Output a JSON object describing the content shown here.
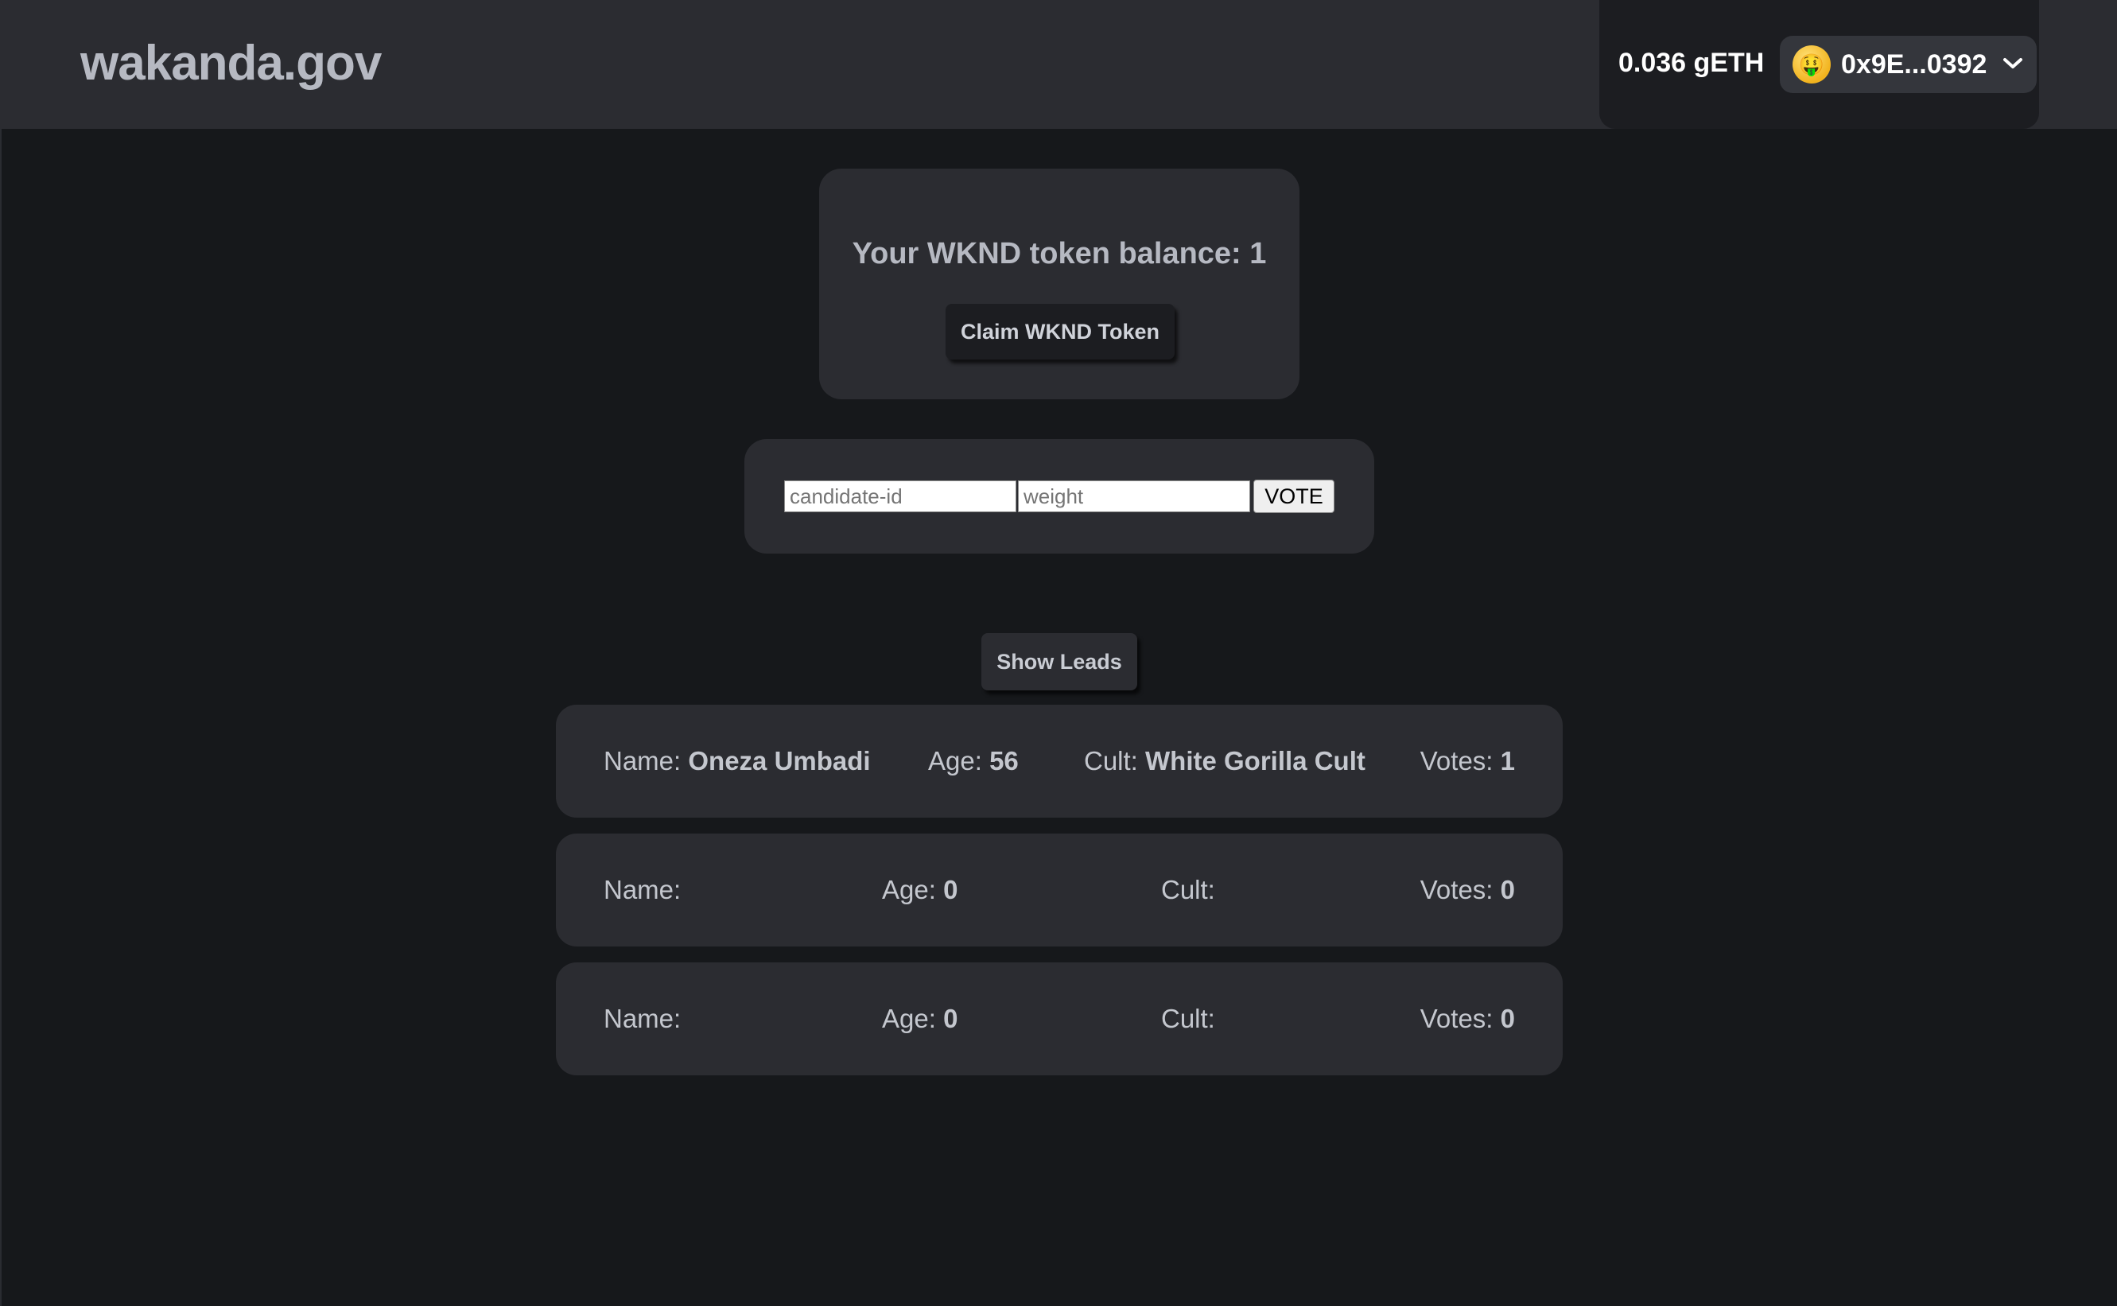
{
  "header": {
    "brand": "wakanda.gov",
    "wallet": {
      "balance": "0.036 gETH",
      "avatar_icon": "🤑",
      "address": "0x9E...0392"
    }
  },
  "token": {
    "balance_text": "Your WKND token balance: 1",
    "claim_label": "Claim WKND Token"
  },
  "vote_form": {
    "candidate_placeholder": "candidate-id",
    "weight_placeholder": "weight",
    "vote_label": "VOTE"
  },
  "leads": {
    "show_label": "Show Leads",
    "labels": {
      "name": "Name:",
      "age": "Age:",
      "cult": "Cult:",
      "votes": "Votes:"
    },
    "rows": [
      {
        "name": "Oneza Umbadi",
        "age": "56",
        "cult": "White Gorilla Cult",
        "votes": "1"
      },
      {
        "name": "",
        "age": "0",
        "cult": "",
        "votes": "0"
      },
      {
        "name": "",
        "age": "0",
        "cult": "",
        "votes": "0"
      }
    ]
  }
}
